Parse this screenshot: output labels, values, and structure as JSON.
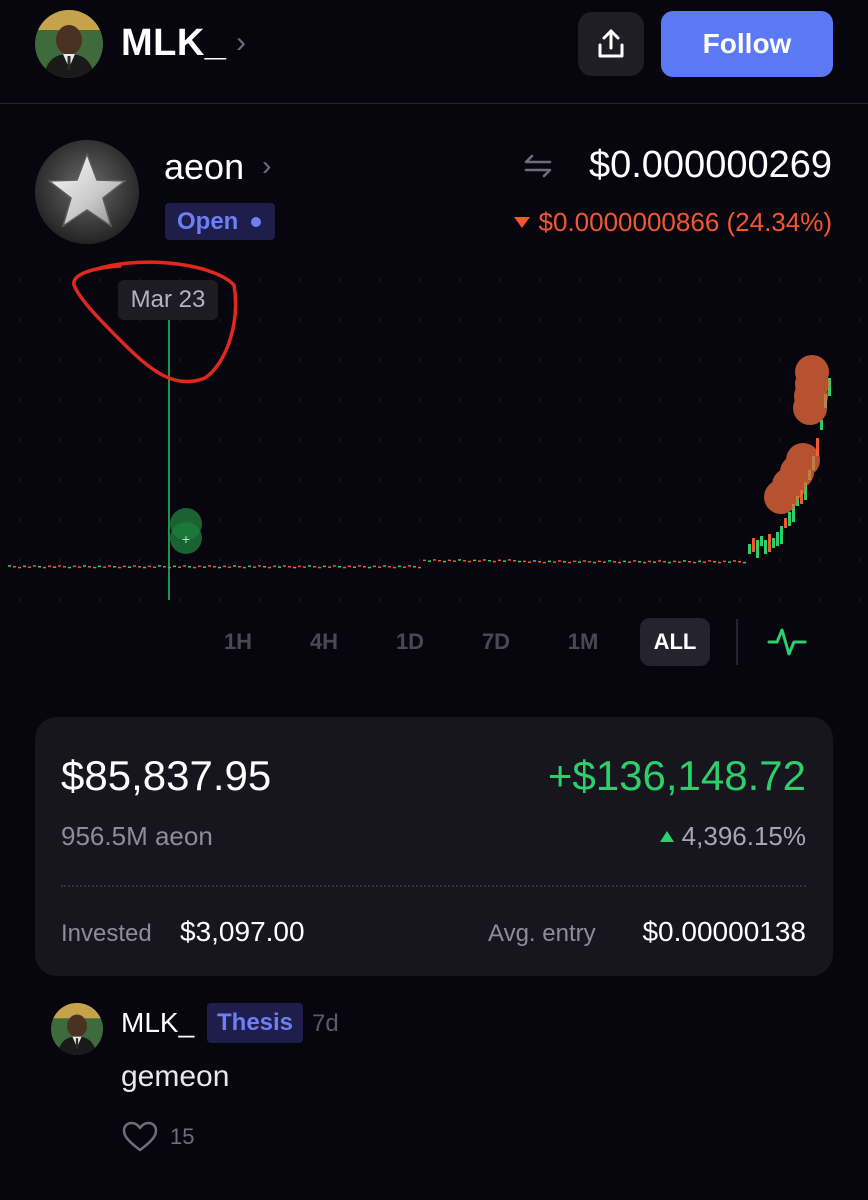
{
  "header": {
    "username": "MLK_",
    "follow_label": "Follow",
    "avatar_icon": "user-avatar-icon",
    "share_icon": "share-icon"
  },
  "token": {
    "name": "aeon",
    "status": "Open",
    "price": "$0.000000269",
    "change": "$0.0000000866 (24.34%)",
    "change_direction": "down",
    "logo_icon": "star-logo-icon",
    "swap_icon": "swap-arrows-icon"
  },
  "chart": {
    "selected_date": "Mar 23",
    "time_ranges": [
      "1H",
      "4H",
      "1D",
      "7D",
      "1M",
      "ALL"
    ],
    "active_range": "ALL",
    "chart_toggle_icon": "pulse-icon"
  },
  "position": {
    "value": "$85,837.95",
    "pnl": "+$136,148.72",
    "holding": "956.5M aeon",
    "pnl_percent": "4,396.15%",
    "invested_label": "Invested",
    "invested_value": "$3,097.00",
    "avg_entry_label": "Avg. entry",
    "avg_entry_value": "$0.00000138"
  },
  "comment": {
    "username": "MLK_",
    "tag": "Thesis",
    "age": "7d",
    "text": "gemeon",
    "likes": "15"
  },
  "colors": {
    "background": "#07060f",
    "accent": "#5b79f4",
    "positive": "#2dcf6b",
    "negative": "#f2572f",
    "badge": "#6c7ff7"
  }
}
